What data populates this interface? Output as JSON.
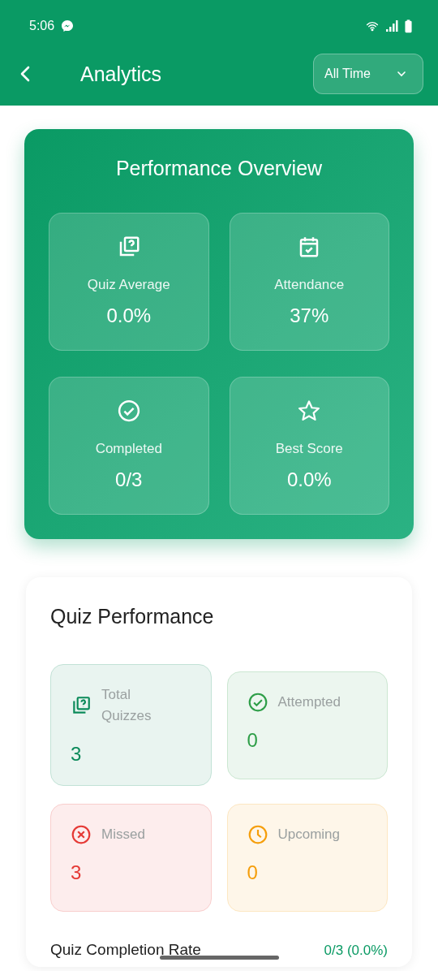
{
  "status_bar": {
    "time": "5:06"
  },
  "app_bar": {
    "title": "Analytics",
    "period_dropdown": {
      "value": "All Time"
    }
  },
  "overview": {
    "title": "Performance Overview",
    "tiles": [
      {
        "kind": "quiz",
        "label": "Quiz Average",
        "value": "0.0%"
      },
      {
        "kind": "calendar",
        "label": "Attendance",
        "value": "37%"
      },
      {
        "kind": "check",
        "label": "Completed",
        "value": "0/3"
      },
      {
        "kind": "star",
        "label": "Best Score",
        "value": "0.0%"
      }
    ]
  },
  "quiz_performance": {
    "title": "Quiz Performance",
    "tiles": [
      {
        "kind": "quiz",
        "label": "Total Quizzes",
        "value": "3",
        "color": "#0b8a5a"
      },
      {
        "kind": "check",
        "label": "Attempted",
        "value": "0",
        "color": "#2e9e48"
      },
      {
        "kind": "missed",
        "label": "Missed",
        "value": "3",
        "color": "#e53935"
      },
      {
        "kind": "clock",
        "label": "Upcoming",
        "value": "0",
        "color": "#f59e0b"
      }
    ],
    "completion": {
      "label": "Quiz Completion Rate",
      "value": "0/3 (0.0%)"
    }
  }
}
